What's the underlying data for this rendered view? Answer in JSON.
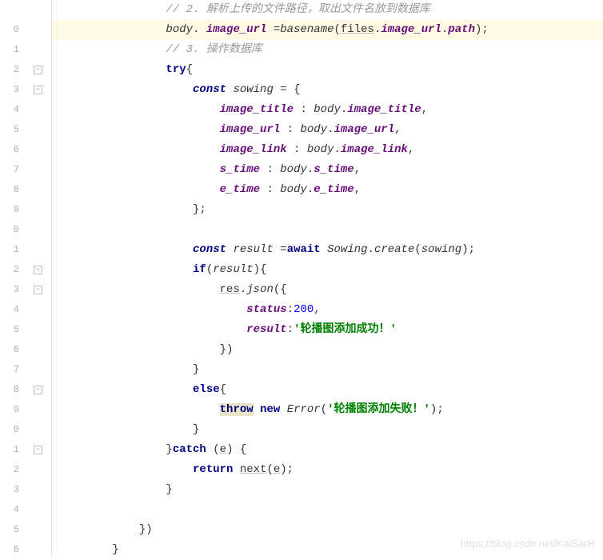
{
  "watermark": "https://blog.csdn.net/KaiSarH",
  "lines": [
    {
      "n": "",
      "indent": 4,
      "tokens": [
        [
          "cm",
          "// 2. 解析上传的文件路径，取出文件名放到数据库"
        ]
      ]
    },
    {
      "n": "0",
      "indent": 4,
      "hl": true,
      "tokens": [
        [
          "id",
          "body"
        ],
        [
          "",
          ". "
        ],
        [
          "prop",
          "image_url"
        ],
        [
          "",
          " ="
        ],
        [
          "fn",
          "basename"
        ],
        [
          "",
          "("
        ],
        [
          "underline",
          "files"
        ],
        [
          "",
          "."
        ],
        [
          "prop",
          "image_url"
        ],
        [
          "",
          "."
        ],
        [
          "prop",
          "path"
        ],
        [
          "",
          ");"
        ]
      ]
    },
    {
      "n": "1",
      "indent": 4,
      "tokens": [
        [
          "cm",
          "// 3. 操作数据库"
        ]
      ]
    },
    {
      "n": "2",
      "indent": 4,
      "fold": true,
      "tokens": [
        [
          "kw",
          "try"
        ],
        [
          "",
          "{"
        ]
      ]
    },
    {
      "n": "3",
      "indent": 5,
      "fold": true,
      "tokens": [
        [
          "kw-it",
          "const "
        ],
        [
          "id",
          "sowing"
        ],
        [
          "",
          " = {"
        ]
      ]
    },
    {
      "n": "4",
      "indent": 6,
      "tokens": [
        [
          "prop",
          "image_title"
        ],
        [
          "",
          " : "
        ],
        [
          "id",
          "body"
        ],
        [
          "",
          "."
        ],
        [
          "prop",
          "image_title"
        ],
        [
          "",
          ","
        ]
      ]
    },
    {
      "n": "5",
      "indent": 6,
      "tokens": [
        [
          "prop",
          "image_url"
        ],
        [
          "",
          " : "
        ],
        [
          "id",
          "body"
        ],
        [
          "",
          "."
        ],
        [
          "prop",
          "image_url"
        ],
        [
          "",
          ","
        ]
      ]
    },
    {
      "n": "6",
      "indent": 6,
      "tokens": [
        [
          "prop",
          "image_link"
        ],
        [
          "",
          " : "
        ],
        [
          "id",
          "body"
        ],
        [
          "",
          "."
        ],
        [
          "prop",
          "image_link"
        ],
        [
          "",
          ","
        ]
      ]
    },
    {
      "n": "7",
      "indent": 6,
      "tokens": [
        [
          "prop",
          "s_time"
        ],
        [
          "",
          " : "
        ],
        [
          "id",
          "body"
        ],
        [
          "",
          "."
        ],
        [
          "prop",
          "s_time"
        ],
        [
          "",
          ","
        ]
      ]
    },
    {
      "n": "8",
      "indent": 6,
      "tokens": [
        [
          "prop",
          "e_time"
        ],
        [
          "",
          " : "
        ],
        [
          "id",
          "body"
        ],
        [
          "",
          "."
        ],
        [
          "prop",
          "e_time"
        ],
        [
          "",
          ","
        ]
      ]
    },
    {
      "n": "9",
      "indent": 5,
      "tokens": [
        [
          "",
          "};"
        ]
      ]
    },
    {
      "n": "0",
      "indent": 0,
      "tokens": []
    },
    {
      "n": "1",
      "indent": 5,
      "tokens": [
        [
          "kw-it",
          "const "
        ],
        [
          "id",
          "result"
        ],
        [
          "",
          " ="
        ],
        [
          "kw",
          "await"
        ],
        [
          "",
          " "
        ],
        [
          "cls",
          "Sowing"
        ],
        [
          "",
          "."
        ],
        [
          "fn",
          "create"
        ],
        [
          "",
          "("
        ],
        [
          "id",
          "sowing"
        ],
        [
          "",
          ");"
        ]
      ]
    },
    {
      "n": "2",
      "indent": 5,
      "fold": true,
      "tokens": [
        [
          "kw",
          "if"
        ],
        [
          "",
          "("
        ],
        [
          "id",
          "result"
        ],
        [
          "",
          ")"
        ],
        [
          "",
          "{"
        ]
      ]
    },
    {
      "n": "3",
      "indent": 6,
      "fold": true,
      "tokens": [
        [
          "underline",
          "res"
        ],
        [
          "",
          "."
        ],
        [
          "fn",
          "json"
        ],
        [
          "",
          "({"
        ]
      ]
    },
    {
      "n": "4",
      "indent": 7,
      "tokens": [
        [
          "prop",
          "status"
        ],
        [
          "",
          ":"
        ],
        [
          "num",
          "200"
        ],
        [
          "",
          ","
        ]
      ]
    },
    {
      "n": "5",
      "indent": 7,
      "tokens": [
        [
          "prop",
          "result"
        ],
        [
          "",
          ":"
        ],
        [
          "str",
          "'轮播图添加成功！'"
        ]
      ]
    },
    {
      "n": "6",
      "indent": 6,
      "tokens": [
        [
          "",
          "})"
        ]
      ]
    },
    {
      "n": "7",
      "indent": 5,
      "tokens": [
        [
          "",
          "}"
        ]
      ]
    },
    {
      "n": "8",
      "indent": 5,
      "fold": true,
      "tokens": [
        [
          "kw",
          "else"
        ],
        [
          "",
          "{"
        ]
      ]
    },
    {
      "n": "9",
      "indent": 6,
      "tokens": [
        [
          "kw hl-word",
          "throw"
        ],
        [
          "",
          " "
        ],
        [
          "kw",
          "new"
        ],
        [
          "",
          " "
        ],
        [
          "cls",
          "Error"
        ],
        [
          "",
          "("
        ],
        [
          "str",
          "'轮播图添加失败！'"
        ],
        [
          "",
          ");"
        ]
      ]
    },
    {
      "n": "0",
      "indent": 5,
      "tokens": [
        [
          "",
          "}"
        ]
      ]
    },
    {
      "n": "1",
      "indent": 4,
      "fold": true,
      "tokens": [
        [
          "",
          "}"
        ],
        [
          "kw",
          "catch"
        ],
        [
          "",
          " ("
        ],
        [
          "underline",
          "e"
        ],
        [
          "",
          ") {"
        ]
      ]
    },
    {
      "n": "2",
      "indent": 5,
      "tokens": [
        [
          "kw",
          "return"
        ],
        [
          "",
          " "
        ],
        [
          "underline",
          "next"
        ],
        [
          "",
          "("
        ],
        [
          "underline",
          "e"
        ],
        [
          "",
          ");"
        ]
      ]
    },
    {
      "n": "3",
      "indent": 4,
      "tokens": [
        [
          "",
          "}"
        ]
      ]
    },
    {
      "n": "4",
      "indent": 0,
      "tokens": []
    },
    {
      "n": "5",
      "indent": 3,
      "tokens": [
        [
          "",
          "})"
        ]
      ]
    },
    {
      "n": "6",
      "indent": 2,
      "tokens": [
        [
          "",
          "}"
        ]
      ]
    }
  ]
}
